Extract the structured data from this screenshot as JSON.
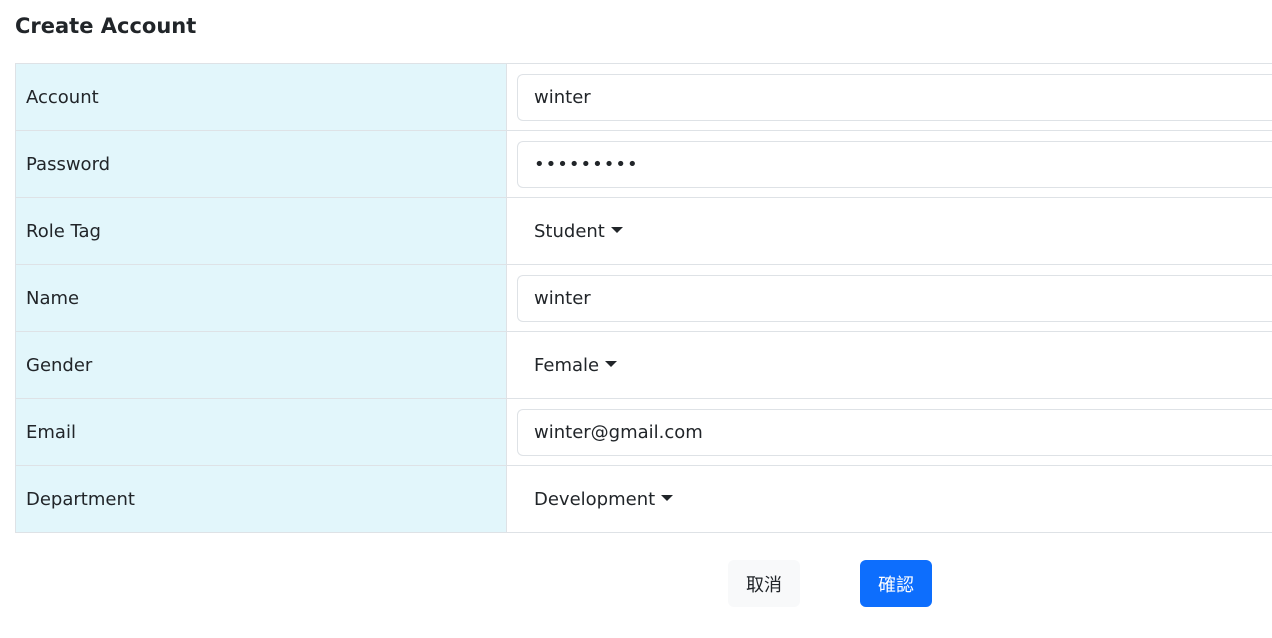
{
  "page": {
    "title": "Create Account"
  },
  "form": {
    "rows": [
      {
        "label": "Account",
        "type": "input",
        "value": "winter"
      },
      {
        "label": "Password",
        "type": "password",
        "value": "•••••••••"
      },
      {
        "label": "Role Tag",
        "type": "dropdown",
        "value": "Student"
      },
      {
        "label": "Name",
        "type": "input",
        "value": "winter"
      },
      {
        "label": "Gender",
        "type": "dropdown",
        "value": "Female"
      },
      {
        "label": "Email",
        "type": "input",
        "value": "winter@gmail.com"
      },
      {
        "label": "Department",
        "type": "dropdown",
        "value": "Development"
      }
    ]
  },
  "actions": {
    "cancel_label": "取消",
    "confirm_label": "確認"
  },
  "colors": {
    "label_bg": "#e2f6fb",
    "primary": "#0d6efd",
    "border": "#dee2e6",
    "cancel_bg": "#f8f9fa"
  },
  "icons": {
    "dropdown": "caret-down-icon"
  }
}
